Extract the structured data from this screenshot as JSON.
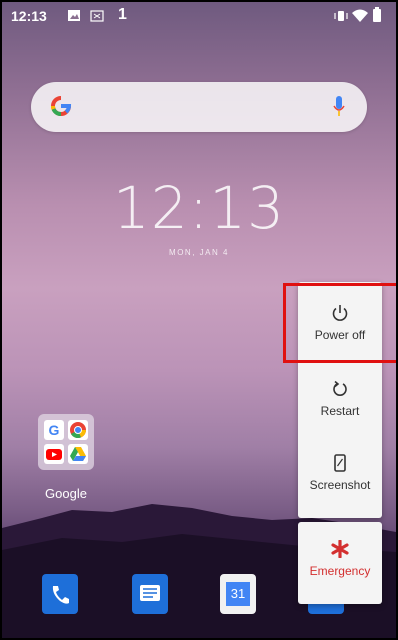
{
  "status_bar": {
    "time": "12:13",
    "notification_count": "1",
    "icons": [
      "image-icon",
      "nfc-icon",
      "vibrate-icon",
      "wifi-icon",
      "battery-icon"
    ]
  },
  "search": {
    "logo": "G",
    "icons": [
      "google-g-icon",
      "mic-icon"
    ]
  },
  "clock": {
    "time": "12:13",
    "date": "MON, JAN 4"
  },
  "home": {
    "folder_label": "Google",
    "folder_apps": [
      "google-search-icon",
      "chrome-icon",
      "youtube-icon",
      "drive-icon"
    ],
    "dock": [
      "phone-icon",
      "messages-icon",
      "calendar-icon",
      "camera-icon"
    ],
    "calendar_day": "31"
  },
  "power_menu": {
    "power_off": "Power off",
    "restart": "Restart",
    "screenshot": "Screenshot",
    "emergency": "Emergency"
  },
  "colors": {
    "highlight": "#e01010",
    "emergency": "#d32f2f",
    "dock_blue": "#1e6fd9"
  }
}
